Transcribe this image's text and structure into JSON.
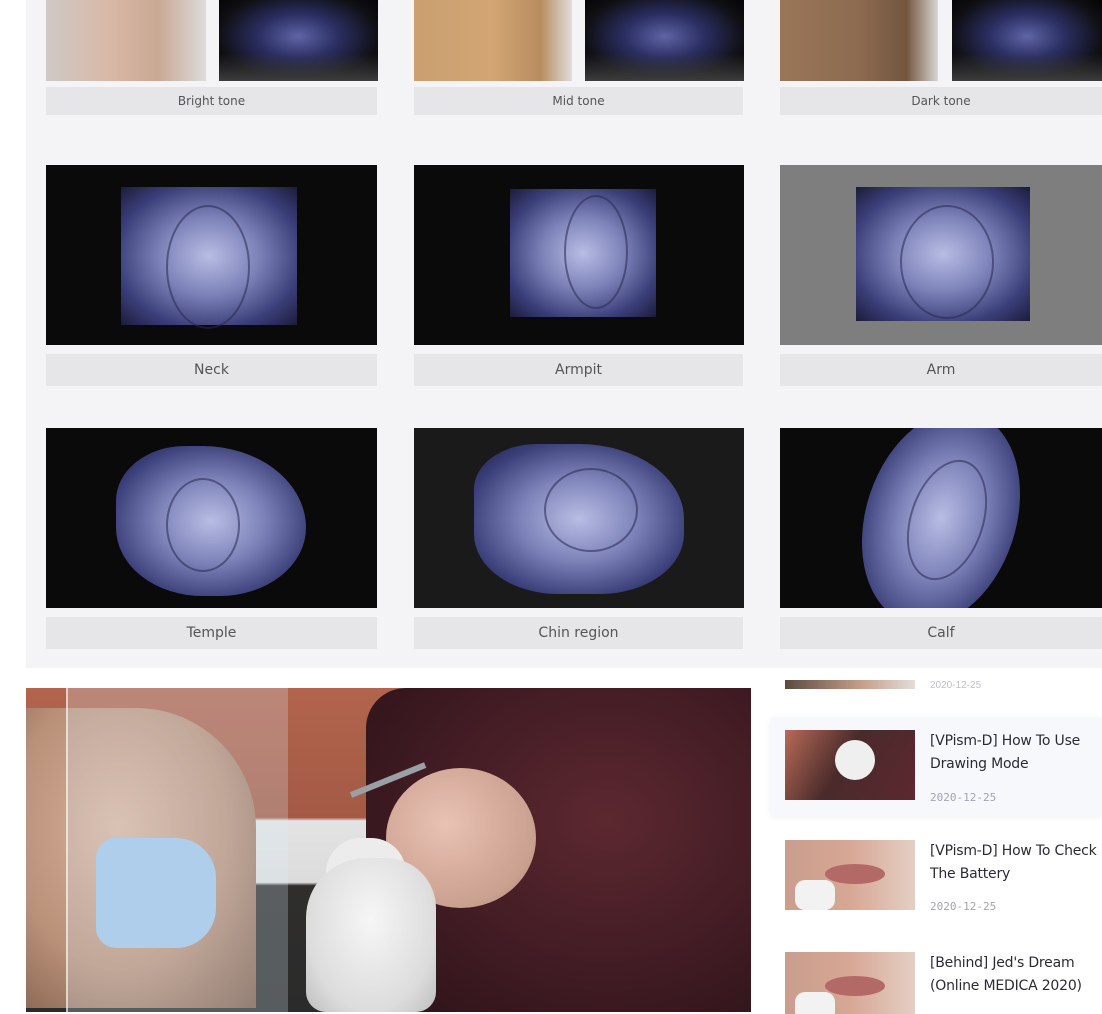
{
  "gallery": {
    "skin_tones": [
      {
        "label": "Bright tone"
      },
      {
        "label": "Mid tone"
      },
      {
        "label": "Dark tone"
      }
    ],
    "body_parts_row1": [
      {
        "label": "Neck"
      },
      {
        "label": "Armpit"
      },
      {
        "label": "Arm"
      }
    ],
    "body_parts_row2": [
      {
        "label": "Temple"
      },
      {
        "label": "Chin region"
      },
      {
        "label": "Calf"
      }
    ]
  },
  "sidebar": {
    "cut_off_date": "2020-12-25",
    "posts": [
      {
        "title": "[VPism-D] How To Use Drawing Mode",
        "date": "2020-12-25",
        "thumb": "vaccination-photo"
      },
      {
        "title": "[VPism-D] How To Check The Battery",
        "date": "2020-12-25",
        "thumb": "lip-injection-photo"
      },
      {
        "title": "[Behind] Jed's Dream (Online MEDICA 2020)",
        "date": "",
        "thumb": "lip-injection-photo"
      }
    ]
  },
  "colors": {
    "gallery_bg": "#f4f4f6",
    "caption_bg": "#e6e6e8",
    "post_title": "#2b2b38",
    "post_date": "#a3a3b4"
  }
}
